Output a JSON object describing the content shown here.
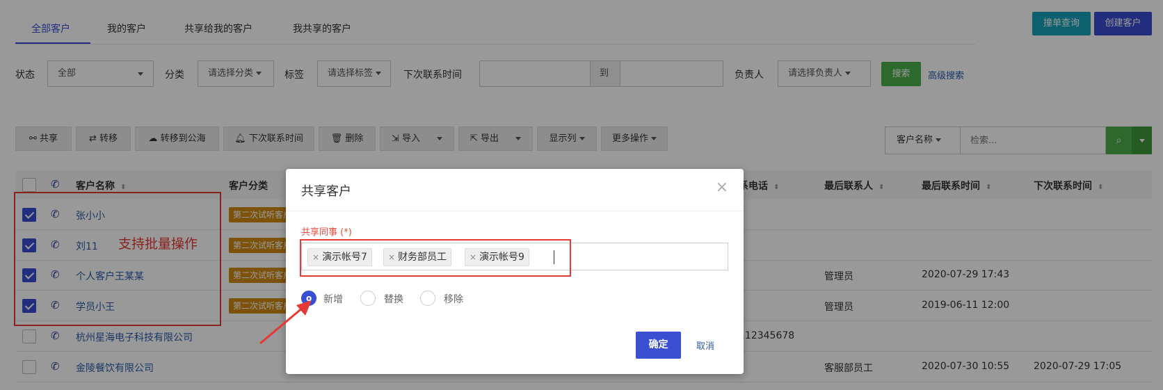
{
  "tabs": [
    "全部客户",
    "我的客户",
    "共享给我的客户",
    "我共享的客户"
  ],
  "top_buttons": {
    "dedup": "撞单查询",
    "create": "创建客户"
  },
  "filters": {
    "status_label": "状态",
    "status_value": "全部",
    "category_label": "分类",
    "category_value": "请选择分类",
    "tag_label": "标签",
    "tag_value": "请选择标签",
    "next_contact_label": "下次联系时间",
    "range_to": "到",
    "owner_label": "负责人",
    "owner_value": "请选择负责人",
    "search_button": "搜索",
    "advanced_search": "高级搜索"
  },
  "toolbar": {
    "share": "共享",
    "transfer": "转移",
    "to_pool": "转移到公海",
    "next_contact": "下次联系时间",
    "delete": "删除",
    "import": "导入",
    "export": "导出",
    "columns": "显示列",
    "more": "更多操作",
    "search_field": "客户名称",
    "search_placeholder": "检索..."
  },
  "table": {
    "headers": [
      "客户名称",
      "客户分类",
      "系电话",
      "最后联系人",
      "最后联系时间",
      "下次联系时间"
    ],
    "rows": [
      {
        "checked": true,
        "name": "张小小",
        "tag": "第二次试听客户",
        "phone": "",
        "last_contact": "",
        "last_time": "",
        "next_time": ""
      },
      {
        "checked": true,
        "name": "刘11",
        "tag": "第二次试听客户",
        "phone": "",
        "last_contact": "",
        "last_time": "",
        "next_time": ""
      },
      {
        "checked": true,
        "name": "个人客户王某某",
        "tag": "第二次试听客户",
        "phone": "",
        "last_contact": "管理员",
        "last_time": "2020-07-29 17:43",
        "next_time": ""
      },
      {
        "checked": true,
        "name": "学员小王",
        "tag": "第二次试听客户",
        "phone": "",
        "last_contact": "管理员",
        "last_time": "2019-06-11 12:00",
        "next_time": ""
      },
      {
        "checked": false,
        "name": "杭州星海电子科技有限公司",
        "tag": "",
        "phone": "112345678",
        "last_contact": "",
        "last_time": "",
        "next_time": ""
      },
      {
        "checked": false,
        "name": "金陵餐饮有限公司",
        "tag": "",
        "phone": "",
        "last_contact": "客服部员工",
        "last_time": "2020-07-30 10:55",
        "next_time": "2020-07-29 17:05"
      }
    ]
  },
  "modal": {
    "title": "共享客户",
    "field_label": "共享同事 (*)",
    "chips": [
      "演示帐号7",
      "财务部员工",
      "演示帐号9"
    ],
    "options": [
      "新增",
      "替换",
      "移除"
    ],
    "selected_option": "新增",
    "ok": "确定",
    "cancel": "取消"
  },
  "annotation": {
    "note": "支持批量操作"
  },
  "colors": {
    "primary": "#3a4ed1",
    "tag": "#d08a14",
    "annotation": "#e53935",
    "teal": "#17a2b8",
    "green": "#4cae4c"
  }
}
